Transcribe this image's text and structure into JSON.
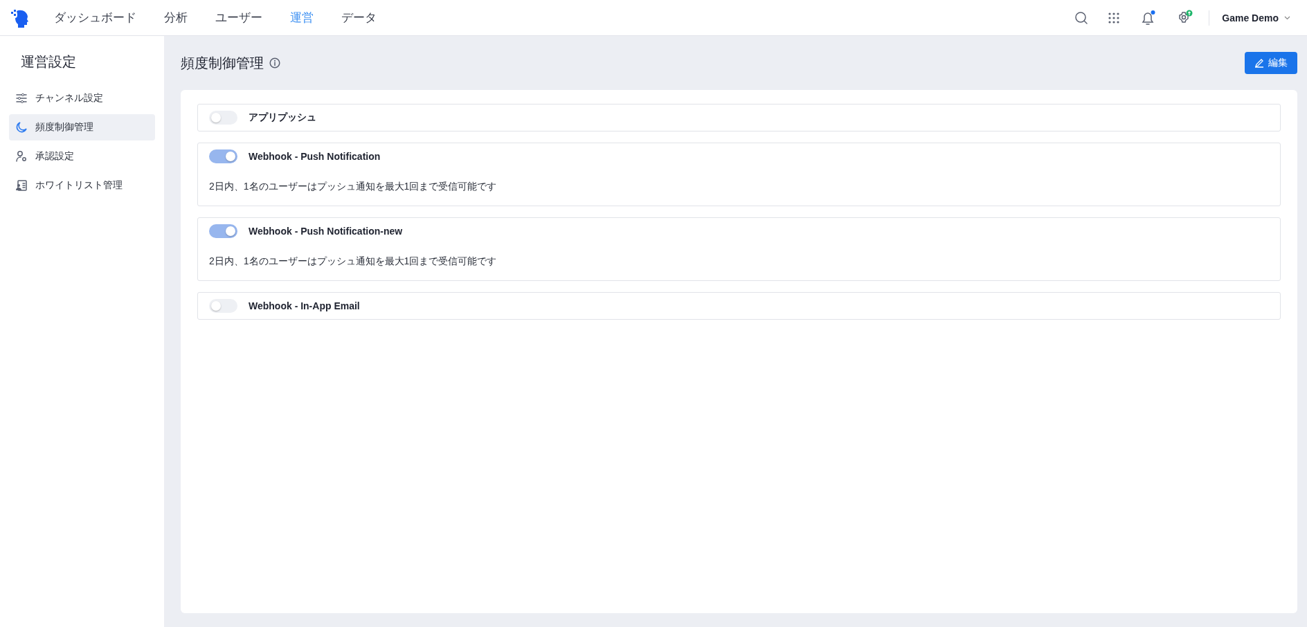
{
  "header": {
    "nav": [
      {
        "label": "ダッシュボード",
        "selected": false
      },
      {
        "label": "分析",
        "selected": false
      },
      {
        "label": "ユーザー",
        "selected": false
      },
      {
        "label": "運営",
        "selected": true
      },
      {
        "label": "データ",
        "selected": false
      }
    ],
    "user_menu": "Game Demo"
  },
  "sidebar": {
    "title": "運営設定",
    "items": [
      {
        "label": "チャンネル設定",
        "selected": false
      },
      {
        "label": "頻度制御管理",
        "selected": true
      },
      {
        "label": "承認設定",
        "selected": false
      },
      {
        "label": "ホワイトリスト管理",
        "selected": false
      }
    ]
  },
  "page": {
    "title": "頻度制御管理",
    "edit_button": "編集",
    "rules": [
      {
        "name": "アプリプッシュ",
        "on": false
      },
      {
        "name": "Webhook - Push Notification",
        "on": true,
        "description": "2日内、1名のユーザーはプッシュ通知を最大1回まで受信可能です"
      },
      {
        "name": "Webhook - Push Notification-new",
        "on": true,
        "description": "2日内、1名のユーザーはプッシュ通知を最大1回まで受信可能です"
      },
      {
        "name": "Webhook - In-App Email",
        "on": false
      }
    ]
  }
}
